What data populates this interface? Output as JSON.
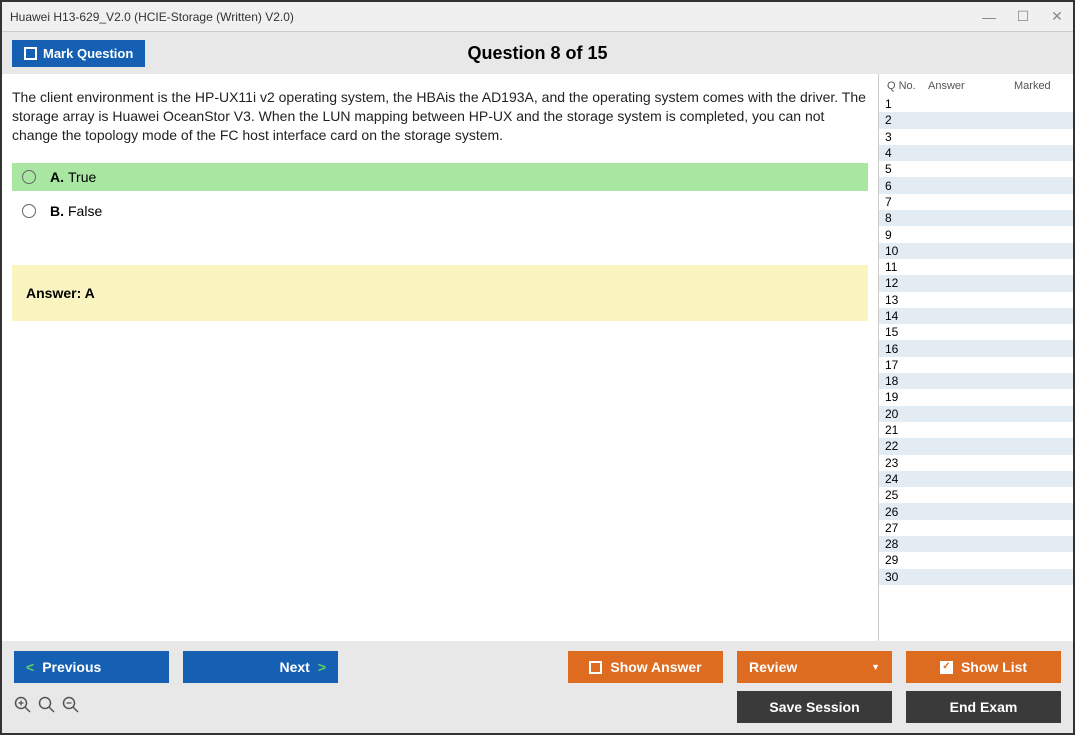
{
  "window": {
    "title": "Huawei H13-629_V2.0 (HCIE-Storage (Written) V2.0)"
  },
  "topbar": {
    "mark_label": "Mark Question",
    "heading": "Question 8 of 15"
  },
  "question": {
    "text": "The client environment is the HP-UX11i v2 operating system, the HBAis the AD193A, and the operating system comes with the driver. The storage array is Huawei OceanStor V3. When the LUN mapping between HP-UX and the storage system is completed, you can not change the topology mode of the FC host interface card on the storage system.",
    "options": [
      {
        "letter": "A.",
        "text": "True",
        "correct": true
      },
      {
        "letter": "B.",
        "text": "False",
        "correct": false
      }
    ],
    "answer_label": "Answer: ",
    "answer_value": "A"
  },
  "sidebar": {
    "head_qno": "Q No.",
    "head_answer": "Answer",
    "head_marked": "Marked",
    "rows": [
      1,
      2,
      3,
      4,
      5,
      6,
      7,
      8,
      9,
      10,
      11,
      12,
      13,
      14,
      15,
      16,
      17,
      18,
      19,
      20,
      21,
      22,
      23,
      24,
      25,
      26,
      27,
      28,
      29,
      30
    ]
  },
  "buttons": {
    "previous": "Previous",
    "next": "Next",
    "show_answer": "Show Answer",
    "review": "Review",
    "show_list": "Show List",
    "save_session": "Save Session",
    "end_exam": "End Exam"
  }
}
